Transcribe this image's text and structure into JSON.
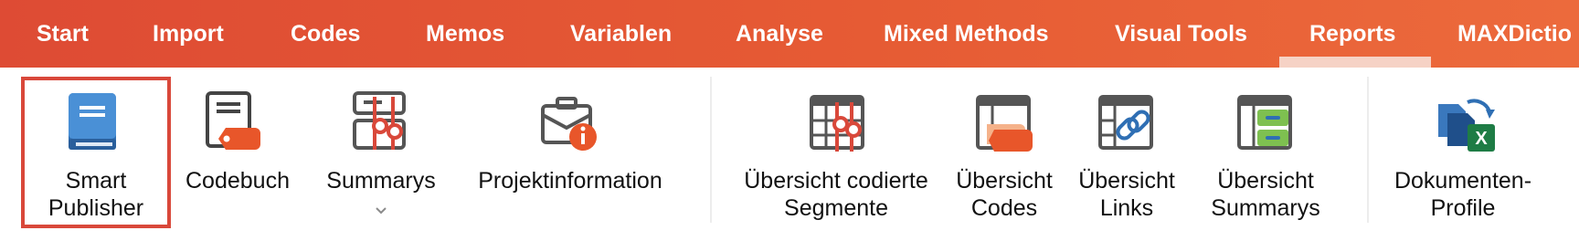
{
  "tabs": [
    "Start",
    "Import",
    "Codes",
    "Memos",
    "Variablen",
    "Analyse",
    "Mixed Methods",
    "Visual Tools",
    "Reports",
    "MAXDictio"
  ],
  "active_tab": "Reports",
  "ribbon": {
    "smart_publisher": {
      "line1": "Smart",
      "line2": "Publisher",
      "icon": "book-icon"
    },
    "codebuch": {
      "label": "Codebuch",
      "icon": "codebook-icon"
    },
    "summarys": {
      "label": "Summarys",
      "icon": "summary-icon",
      "dropdown": "chevron-down-icon"
    },
    "projektinformation": {
      "label": "Projektinformation",
      "icon": "briefcase-info-icon"
    },
    "uebersicht_codierte_segmente": {
      "line1": "Übersicht codierte",
      "line2": "Segmente",
      "icon": "table-segments-icon"
    },
    "uebersicht_codes": {
      "line1": "Übersicht",
      "line2": "Codes",
      "icon": "table-codes-icon"
    },
    "uebersicht_links": {
      "line1": "Übersicht",
      "line2": "Links",
      "icon": "table-links-icon"
    },
    "uebersicht_summarys": {
      "line1": "Übersicht",
      "line2": "Summarys",
      "icon": "table-summarys-icon"
    },
    "dokumenten_profile": {
      "line1": "Dokumenten-",
      "line2": "Profile",
      "icon": "excel-export-icon"
    }
  },
  "colors": {
    "accent": "#e65b34",
    "highlight": "#d9483a",
    "book": "#2f6fb4",
    "tag": "#e8562a",
    "green": "#7ec050",
    "excel": "#1e7c45"
  }
}
